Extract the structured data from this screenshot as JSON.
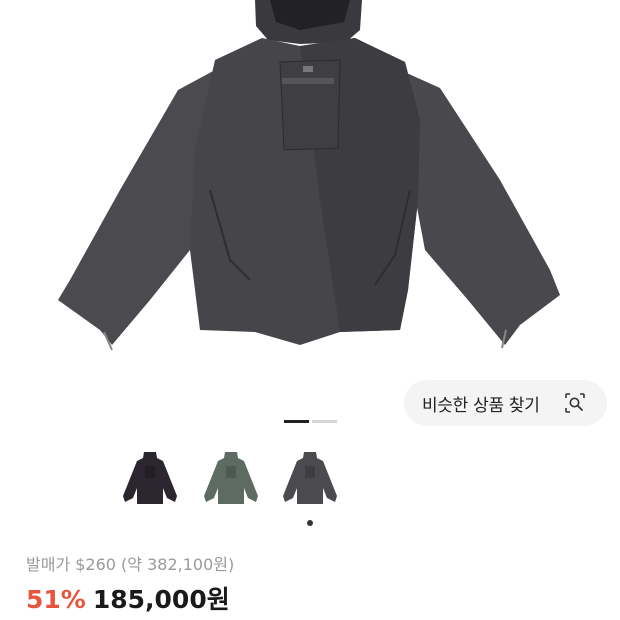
{
  "product": {
    "image_alt": "dark grey hooded anorak jacket",
    "colors": {
      "jacket": "#4a4a4d",
      "jacket_dark": "#2f2f33",
      "thumb_black": "#2b2630",
      "thumb_green": "#5d6b63",
      "thumb_grey": "#4b4b4f"
    }
  },
  "similar_button": {
    "label": "비슷한 상품 찾기",
    "icon": "visual-search-icon"
  },
  "gallery": {
    "current": 1,
    "total": 2
  },
  "thumbnails": [
    {
      "name": "black",
      "selected": false
    },
    {
      "name": "green",
      "selected": false
    },
    {
      "name": "grey",
      "selected": true
    }
  ],
  "pricing": {
    "original_label": "발매가 $260 (약 382,100원)",
    "discount": "51%",
    "price": "185,000원",
    "discount_color": "#e8553d"
  }
}
